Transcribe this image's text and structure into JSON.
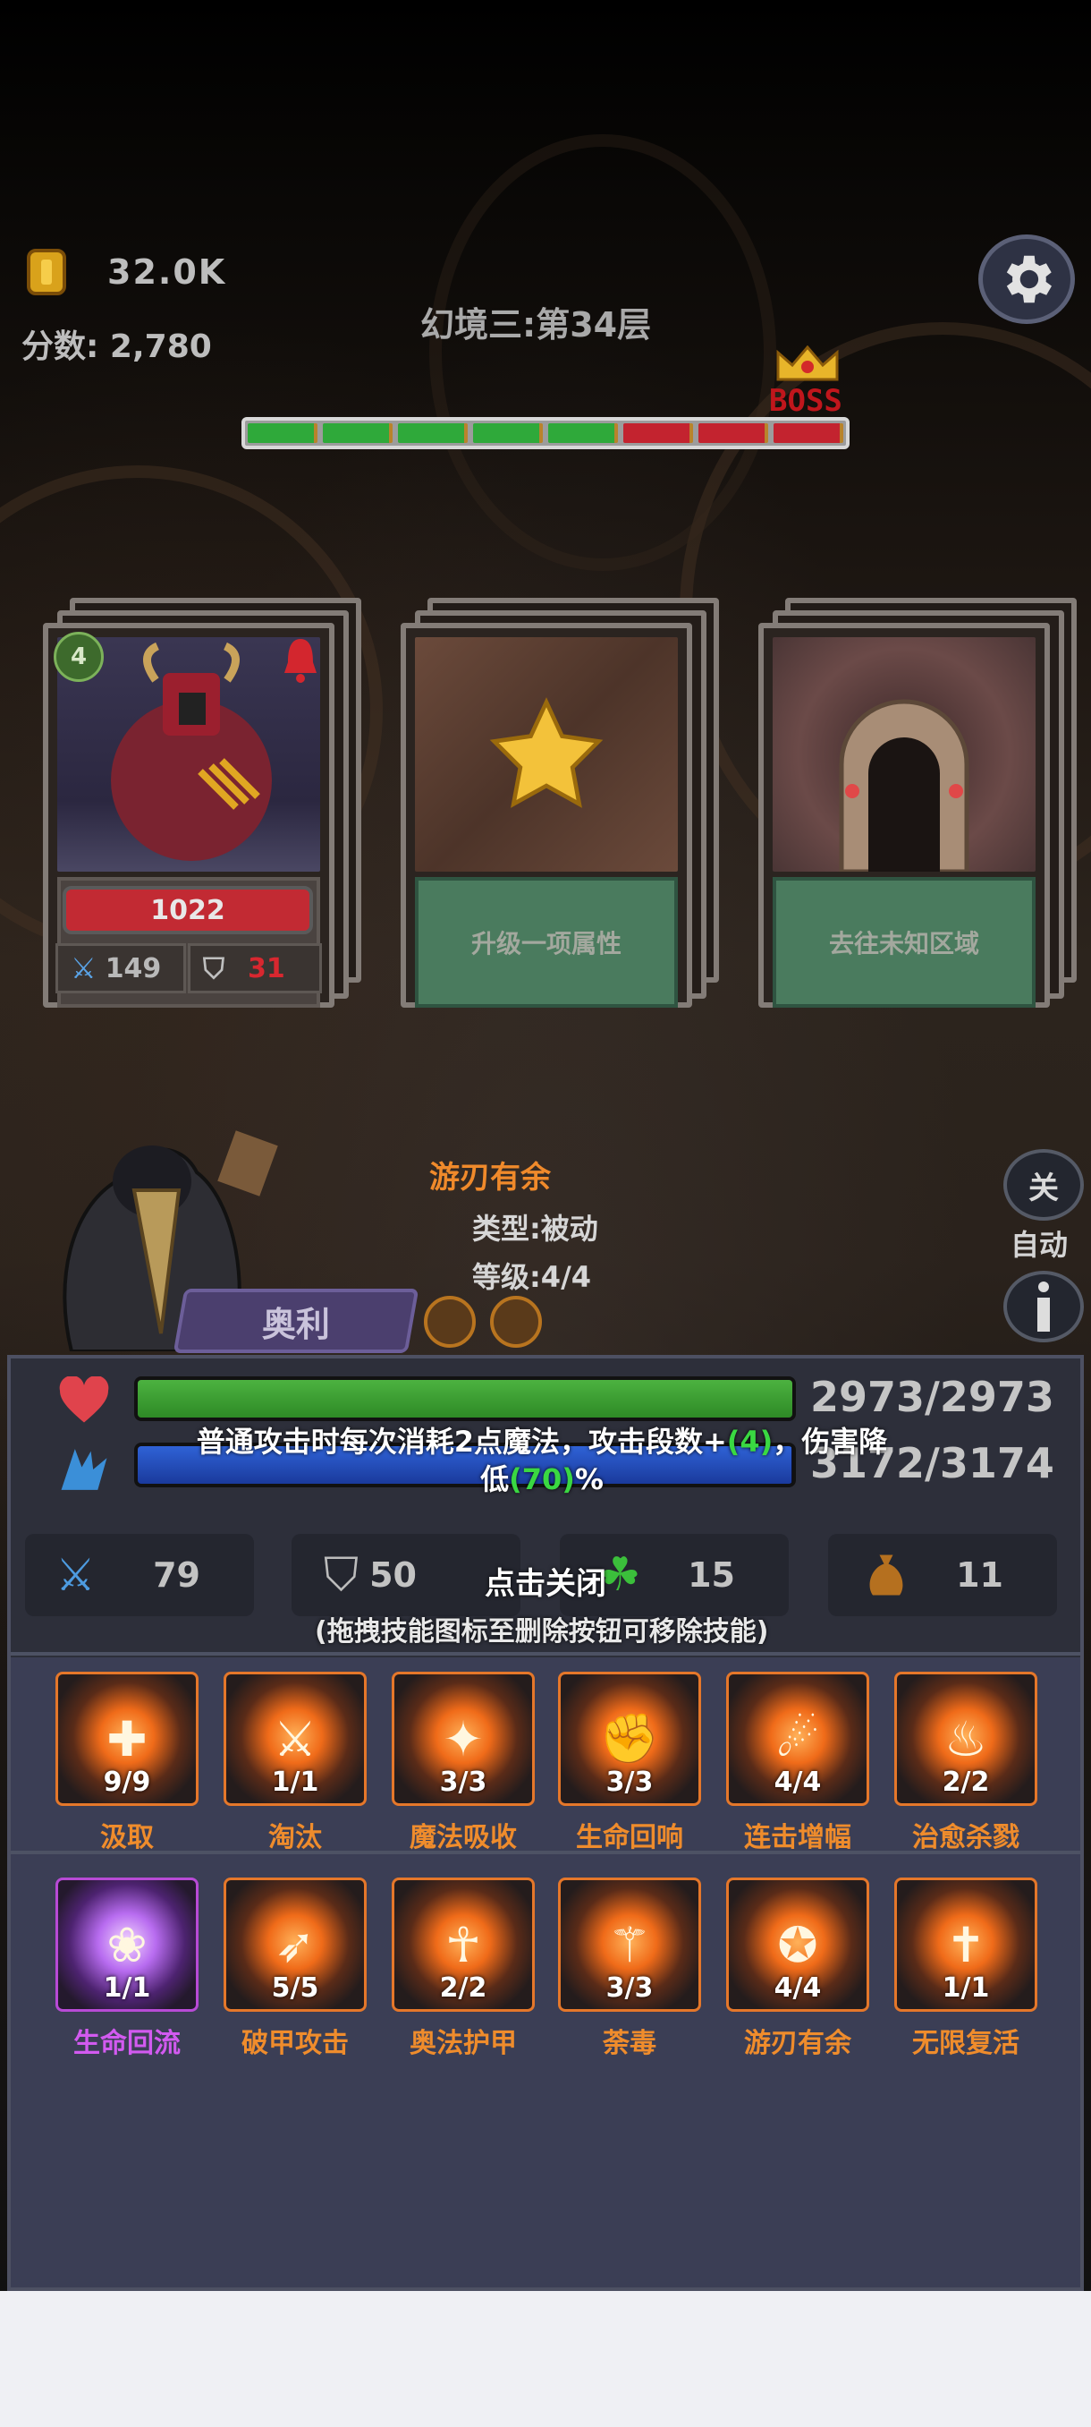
{
  "hud": {
    "coins": "32.0K",
    "score": "分数: 2,780",
    "floor_title": "幻境三:第34层",
    "boss_label": "BOSS",
    "progress_segments": [
      "green",
      "green",
      "green",
      "green",
      "green",
      "red",
      "red",
      "red"
    ]
  },
  "cards": [
    {
      "type": "enemy",
      "level": "4",
      "hp": "1022",
      "attack": "149",
      "defense": "31"
    },
    {
      "type": "reward",
      "label": "升级一项属性"
    },
    {
      "type": "door",
      "label": "去往未知区域"
    }
  ],
  "tooltip": {
    "title": "游刃有余",
    "type_line": "类型:被动",
    "level_line": "等级:4/4"
  },
  "side": {
    "close_button": "关",
    "auto_label": "自动"
  },
  "hero": {
    "name": "奥利"
  },
  "status": {
    "hp": "2973/2973",
    "mp": "3172/3174",
    "hp_fill": 1.0,
    "mp_fill": 0.999
  },
  "description": {
    "part1": "普通攻击时每次消耗2点魔法，攻击段数+",
    "hl1": "(4)",
    "part2": "，伤害降低",
    "hl2": "(70)",
    "part3": "%"
  },
  "stats": [
    {
      "icon": "sword-icon",
      "value": "79"
    },
    {
      "icon": "shield-icon",
      "value": "50"
    },
    {
      "icon": "clover-icon",
      "value": "15"
    },
    {
      "icon": "bag-icon",
      "value": "11"
    }
  ],
  "close_hint": "点击关闭",
  "drag_hint": "(拖拽技能图标至删除按钮可移除技能)",
  "skills_row1": [
    {
      "name": "汲取",
      "count": "9/9",
      "icon": "heal-cross-icon"
    },
    {
      "name": "淘汰",
      "count": "1/1",
      "icon": "slash-icon"
    },
    {
      "name": "魔法吸收",
      "count": "3/3",
      "icon": "wing-icon"
    },
    {
      "name": "生命回响",
      "count": "3/3",
      "icon": "muscle-icon"
    },
    {
      "name": "连击增幅",
      "count": "4/4",
      "icon": "fighter-icon"
    },
    {
      "name": "治愈杀戮",
      "count": "2/2",
      "icon": "altar-icon"
    }
  ],
  "skills_row2": [
    {
      "name": "生命回流",
      "count": "1/1",
      "icon": "flower-icon",
      "highlight": "purple"
    },
    {
      "name": "破甲攻击",
      "count": "5/5",
      "icon": "arrow-icon"
    },
    {
      "name": "奥法护甲",
      "count": "2/2",
      "icon": "guardian-icon"
    },
    {
      "name": "荼毒",
      "count": "3/3",
      "icon": "blade-icon"
    },
    {
      "name": "游刃有余",
      "count": "4/4",
      "icon": "spin-icon"
    },
    {
      "name": "无限复活",
      "count": "1/1",
      "icon": "ankh-icon"
    }
  ]
}
